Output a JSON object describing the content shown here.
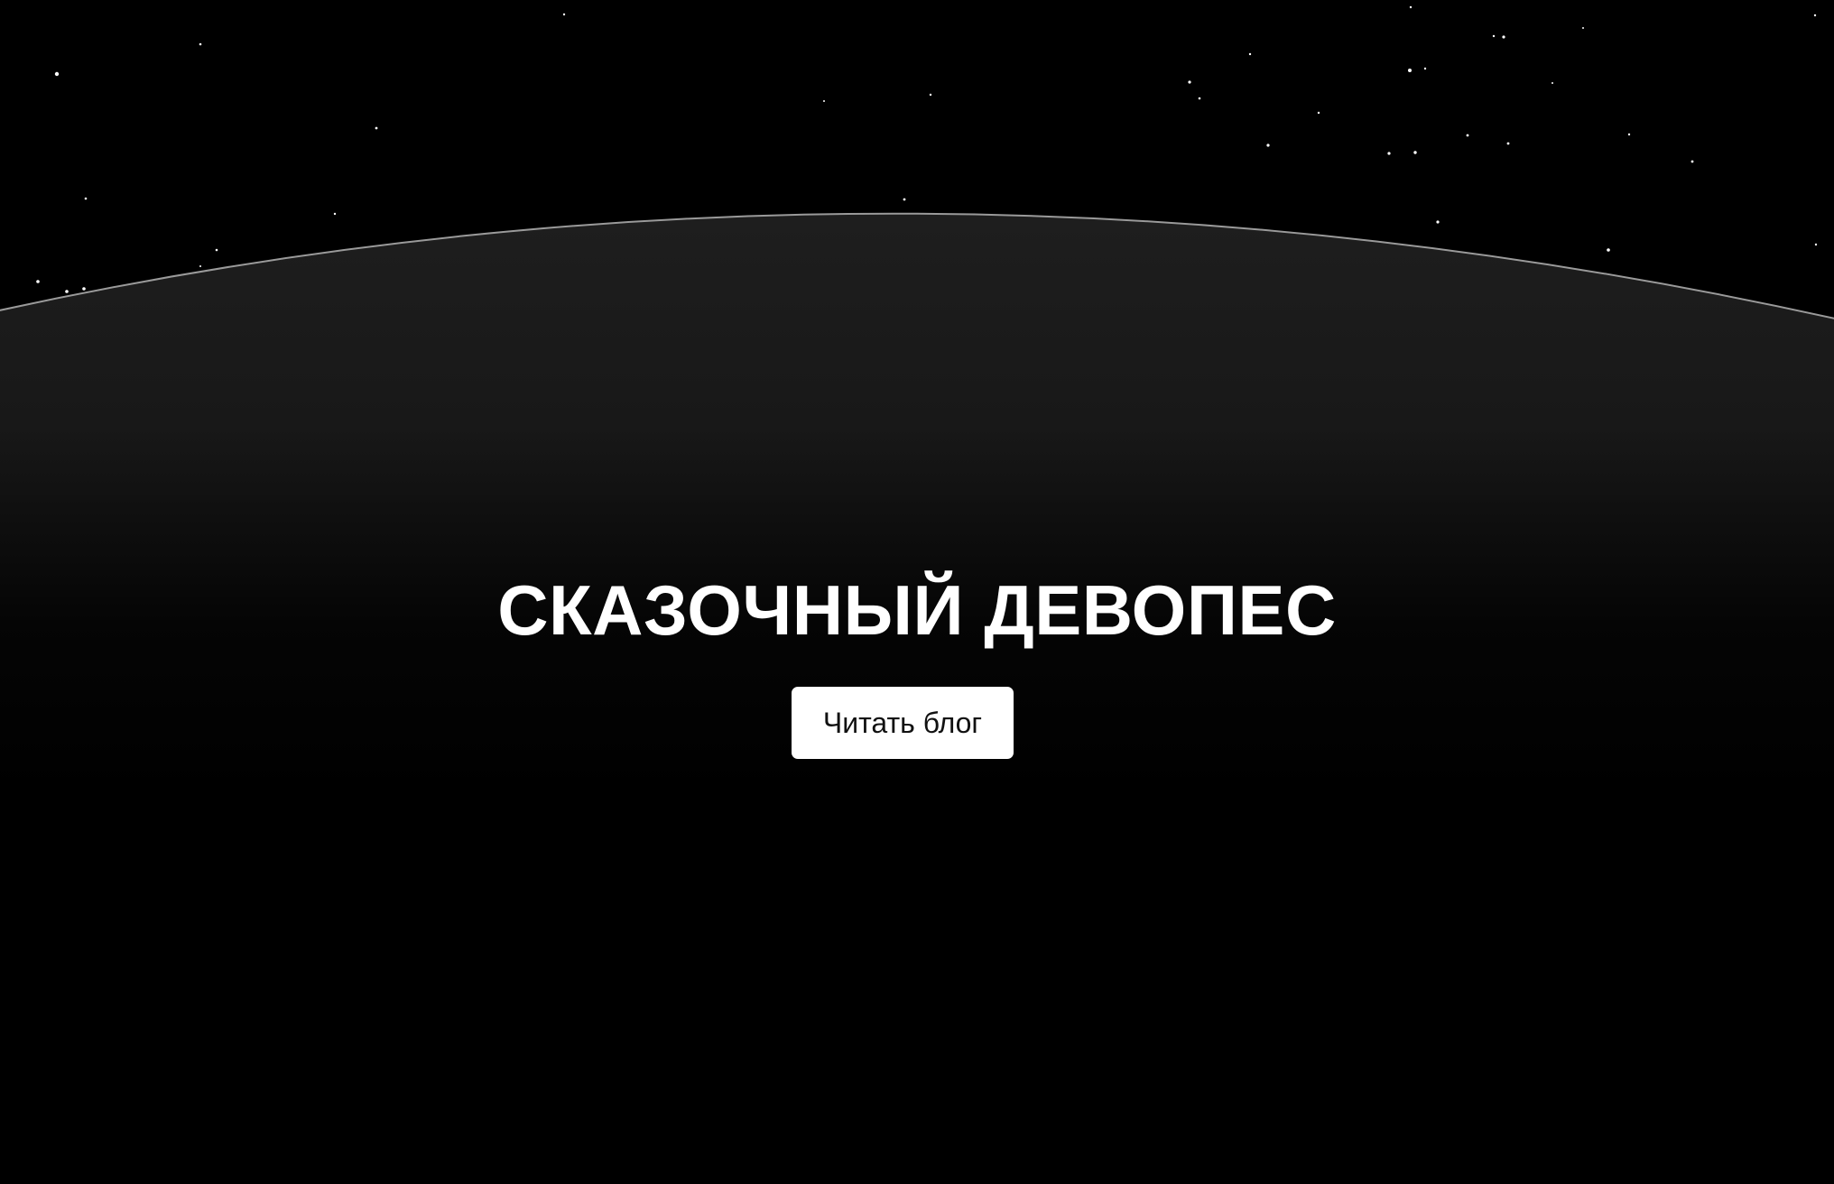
{
  "hero": {
    "title": "СКАЗОЧНЫЙ ДЕВОПЕС",
    "cta_label": "Читать блог"
  },
  "colors": {
    "background": "#000000",
    "planet_surface": "#1c1c1c",
    "horizon_line": "#9a9a9a",
    "text": "#ffffff",
    "button_bg": "#ffffff",
    "button_text": "#111111"
  }
}
